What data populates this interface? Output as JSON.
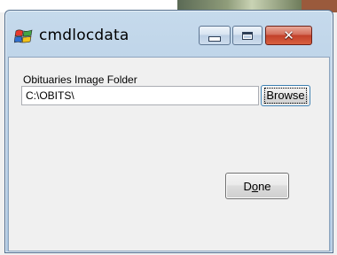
{
  "window": {
    "title": "cmdlocdata",
    "controls": {
      "minimize_icon": "minimize-icon",
      "maximize_icon": "maximize-icon",
      "close_icon": "close-icon"
    },
    "app_icon": "windows-flag-icon"
  },
  "form": {
    "folder_label": "Obituaries Image Folder",
    "folder_value": "C:\\OBITS\\",
    "browse_label": "Browse",
    "done_label_prefix": "D",
    "done_label_underlined": "o",
    "done_label_suffix": "ne"
  },
  "colors": {
    "title_bar": "#b9d0e6",
    "close_button": "#c2402a",
    "focus_border": "#3c7fb1"
  }
}
